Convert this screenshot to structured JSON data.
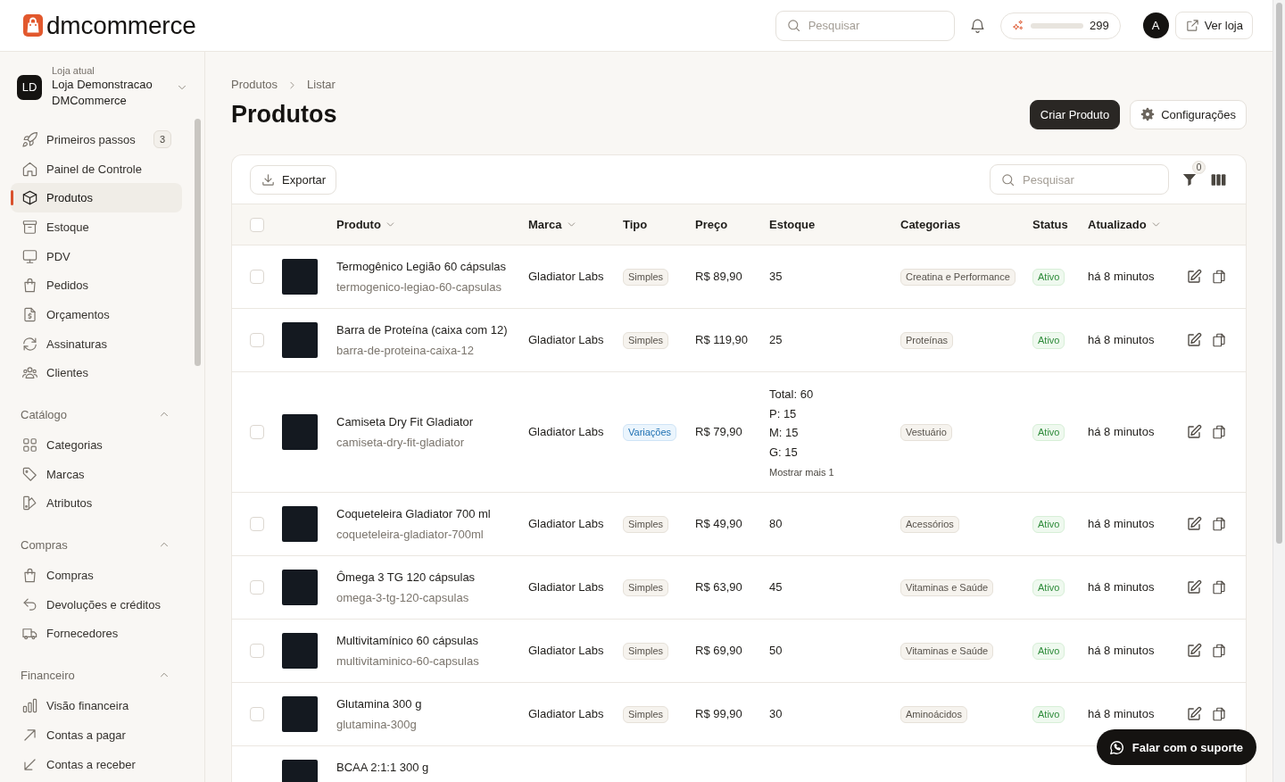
{
  "header": {
    "logo": "dmcommerce",
    "search": {
      "placeholder": "Pesquisar"
    },
    "credits": {
      "level": 0,
      "amount": "299"
    },
    "avatar": "A",
    "store_link": "Ver loja"
  },
  "sidebar": {
    "store": {
      "caption": "Loja atual",
      "initials": "LD",
      "name": "Loja Demonstracao DMCommerce"
    },
    "items": [
      {
        "label": "Primeiros passos",
        "badge": "3",
        "selected": false
      },
      {
        "label": "Painel de Controle",
        "selected": false
      },
      {
        "label": "Produtos",
        "selected": true
      },
      {
        "label": "Estoque",
        "selected": false
      },
      {
        "label": "PDV",
        "selected": false
      },
      {
        "label": "Pedidos",
        "selected": false
      },
      {
        "label": "Orçamentos",
        "selected": false
      },
      {
        "label": "Assinaturas",
        "selected": false
      },
      {
        "label": "Clientes",
        "selected": false
      }
    ],
    "sections": [
      {
        "title": "Catálogo",
        "expanded": true,
        "items": [
          {
            "label": "Categorias",
            "selected": false
          },
          {
            "label": "Marcas",
            "selected": false
          },
          {
            "label": "Atributos",
            "selected": false
          }
        ]
      },
      {
        "title": "Compras",
        "expanded": true,
        "items": [
          {
            "label": "Compras",
            "selected": false
          },
          {
            "label": "Devoluções e créditos",
            "selected": false
          },
          {
            "label": "Fornecedores",
            "selected": false
          }
        ]
      },
      {
        "title": "Financeiro",
        "expanded": true,
        "items": [
          {
            "label": "Visão financeira",
            "selected": false
          },
          {
            "label": "Contas a pagar",
            "selected": false
          },
          {
            "label": "Contas a receber",
            "selected": false
          }
        ]
      }
    ]
  },
  "page": {
    "breadcrumb": [
      "Produtos",
      "Listar"
    ],
    "title": "Produtos",
    "actions": [
      {
        "label": "Criar Produto",
        "kind": "primary"
      },
      {
        "label": "Configurações",
        "kind": "settings"
      }
    ]
  },
  "table": {
    "toolbar": {
      "export": "Exportar",
      "search": {
        "placeholder": "Pesquisar"
      },
      "filter_count": "0"
    },
    "all_checked": false,
    "columns": [
      {
        "label": "Produto",
        "sortable": true
      },
      {
        "label": "Marca",
        "sortable": true
      },
      {
        "label": "Tipo",
        "sortable": false
      },
      {
        "label": "Preço",
        "sortable": false
      },
      {
        "label": "Estoque",
        "sortable": false
      },
      {
        "label": "Categorias",
        "sortable": false
      },
      {
        "label": "Status",
        "sortable": false
      },
      {
        "label": "Atualizado",
        "sortable": true
      }
    ],
    "rows": [
      {
        "checked": false,
        "name": "Termogênico Legião 60 cápsulas",
        "slug": "termogenico-legiao-60-capsulas",
        "brand": "Gladiator Labs",
        "type": {
          "label": "Simples",
          "kind": "simple"
        },
        "price": "R$ 89,90",
        "stock": [
          "35"
        ],
        "category": "Creatina e Performance",
        "status": {
          "label": "Ativo",
          "kind": "active"
        },
        "updated": "há 8 minutos"
      },
      {
        "checked": false,
        "name": "Barra de Proteína (caixa com 12)",
        "slug": "barra-de-proteina-caixa-12",
        "brand": "Gladiator Labs",
        "type": {
          "label": "Simples",
          "kind": "simple"
        },
        "price": "R$ 119,90",
        "stock": [
          "25"
        ],
        "category": "Proteínas",
        "status": {
          "label": "Ativo",
          "kind": "active"
        },
        "updated": "há 8 minutos"
      },
      {
        "checked": false,
        "name": "Camiseta Dry Fit Gladiator",
        "slug": "camiseta-dry-fit-gladiator",
        "brand": "Gladiator Labs",
        "type": {
          "label": "Variações",
          "kind": "variable"
        },
        "price": "R$ 79,90",
        "stock": [
          "Total: 60",
          "P: 15",
          "M: 15",
          "G: 15"
        ],
        "stock_more": "Mostrar mais 1",
        "category": "Vestuário",
        "status": {
          "label": "Ativo",
          "kind": "active"
        },
        "updated": "há 8 minutos"
      },
      {
        "checked": false,
        "name": "Coqueteleira Gladiator 700 ml",
        "slug": "coqueteleira-gladiator-700ml",
        "brand": "Gladiator Labs",
        "type": {
          "label": "Simples",
          "kind": "simple"
        },
        "price": "R$ 49,90",
        "stock": [
          "80"
        ],
        "category": "Acessórios",
        "status": {
          "label": "Ativo",
          "kind": "active"
        },
        "updated": "há 8 minutos"
      },
      {
        "checked": false,
        "name": "Ômega 3 TG 120 cápsulas",
        "slug": "omega-3-tg-120-capsulas",
        "brand": "Gladiator Labs",
        "type": {
          "label": "Simples",
          "kind": "simple"
        },
        "price": "R$ 63,90",
        "stock": [
          "45"
        ],
        "category": "Vitaminas e Saúde",
        "status": {
          "label": "Ativo",
          "kind": "active"
        },
        "updated": "há 8 minutos"
      },
      {
        "checked": false,
        "name": "Multivitamínico 60 cápsulas",
        "slug": "multivitaminico-60-capsulas",
        "brand": "Gladiator Labs",
        "type": {
          "label": "Simples",
          "kind": "simple"
        },
        "price": "R$ 69,90",
        "stock": [
          "50"
        ],
        "category": "Vitaminas e Saúde",
        "status": {
          "label": "Ativo",
          "kind": "active"
        },
        "updated": "há 8 minutos"
      },
      {
        "checked": false,
        "name": "Glutamina 300 g",
        "slug": "glutamina-300g",
        "brand": "Gladiator Labs",
        "type": {
          "label": "Simples",
          "kind": "simple"
        },
        "price": "R$ 99,90",
        "stock": [
          "30"
        ],
        "category": "Aminoácidos",
        "status": {
          "label": "Ativo",
          "kind": "active"
        },
        "updated": "há 8 minutos"
      },
      {
        "name": "BCAA 2:1:1 300 g"
      }
    ]
  },
  "support": "Falar com o suporte"
}
